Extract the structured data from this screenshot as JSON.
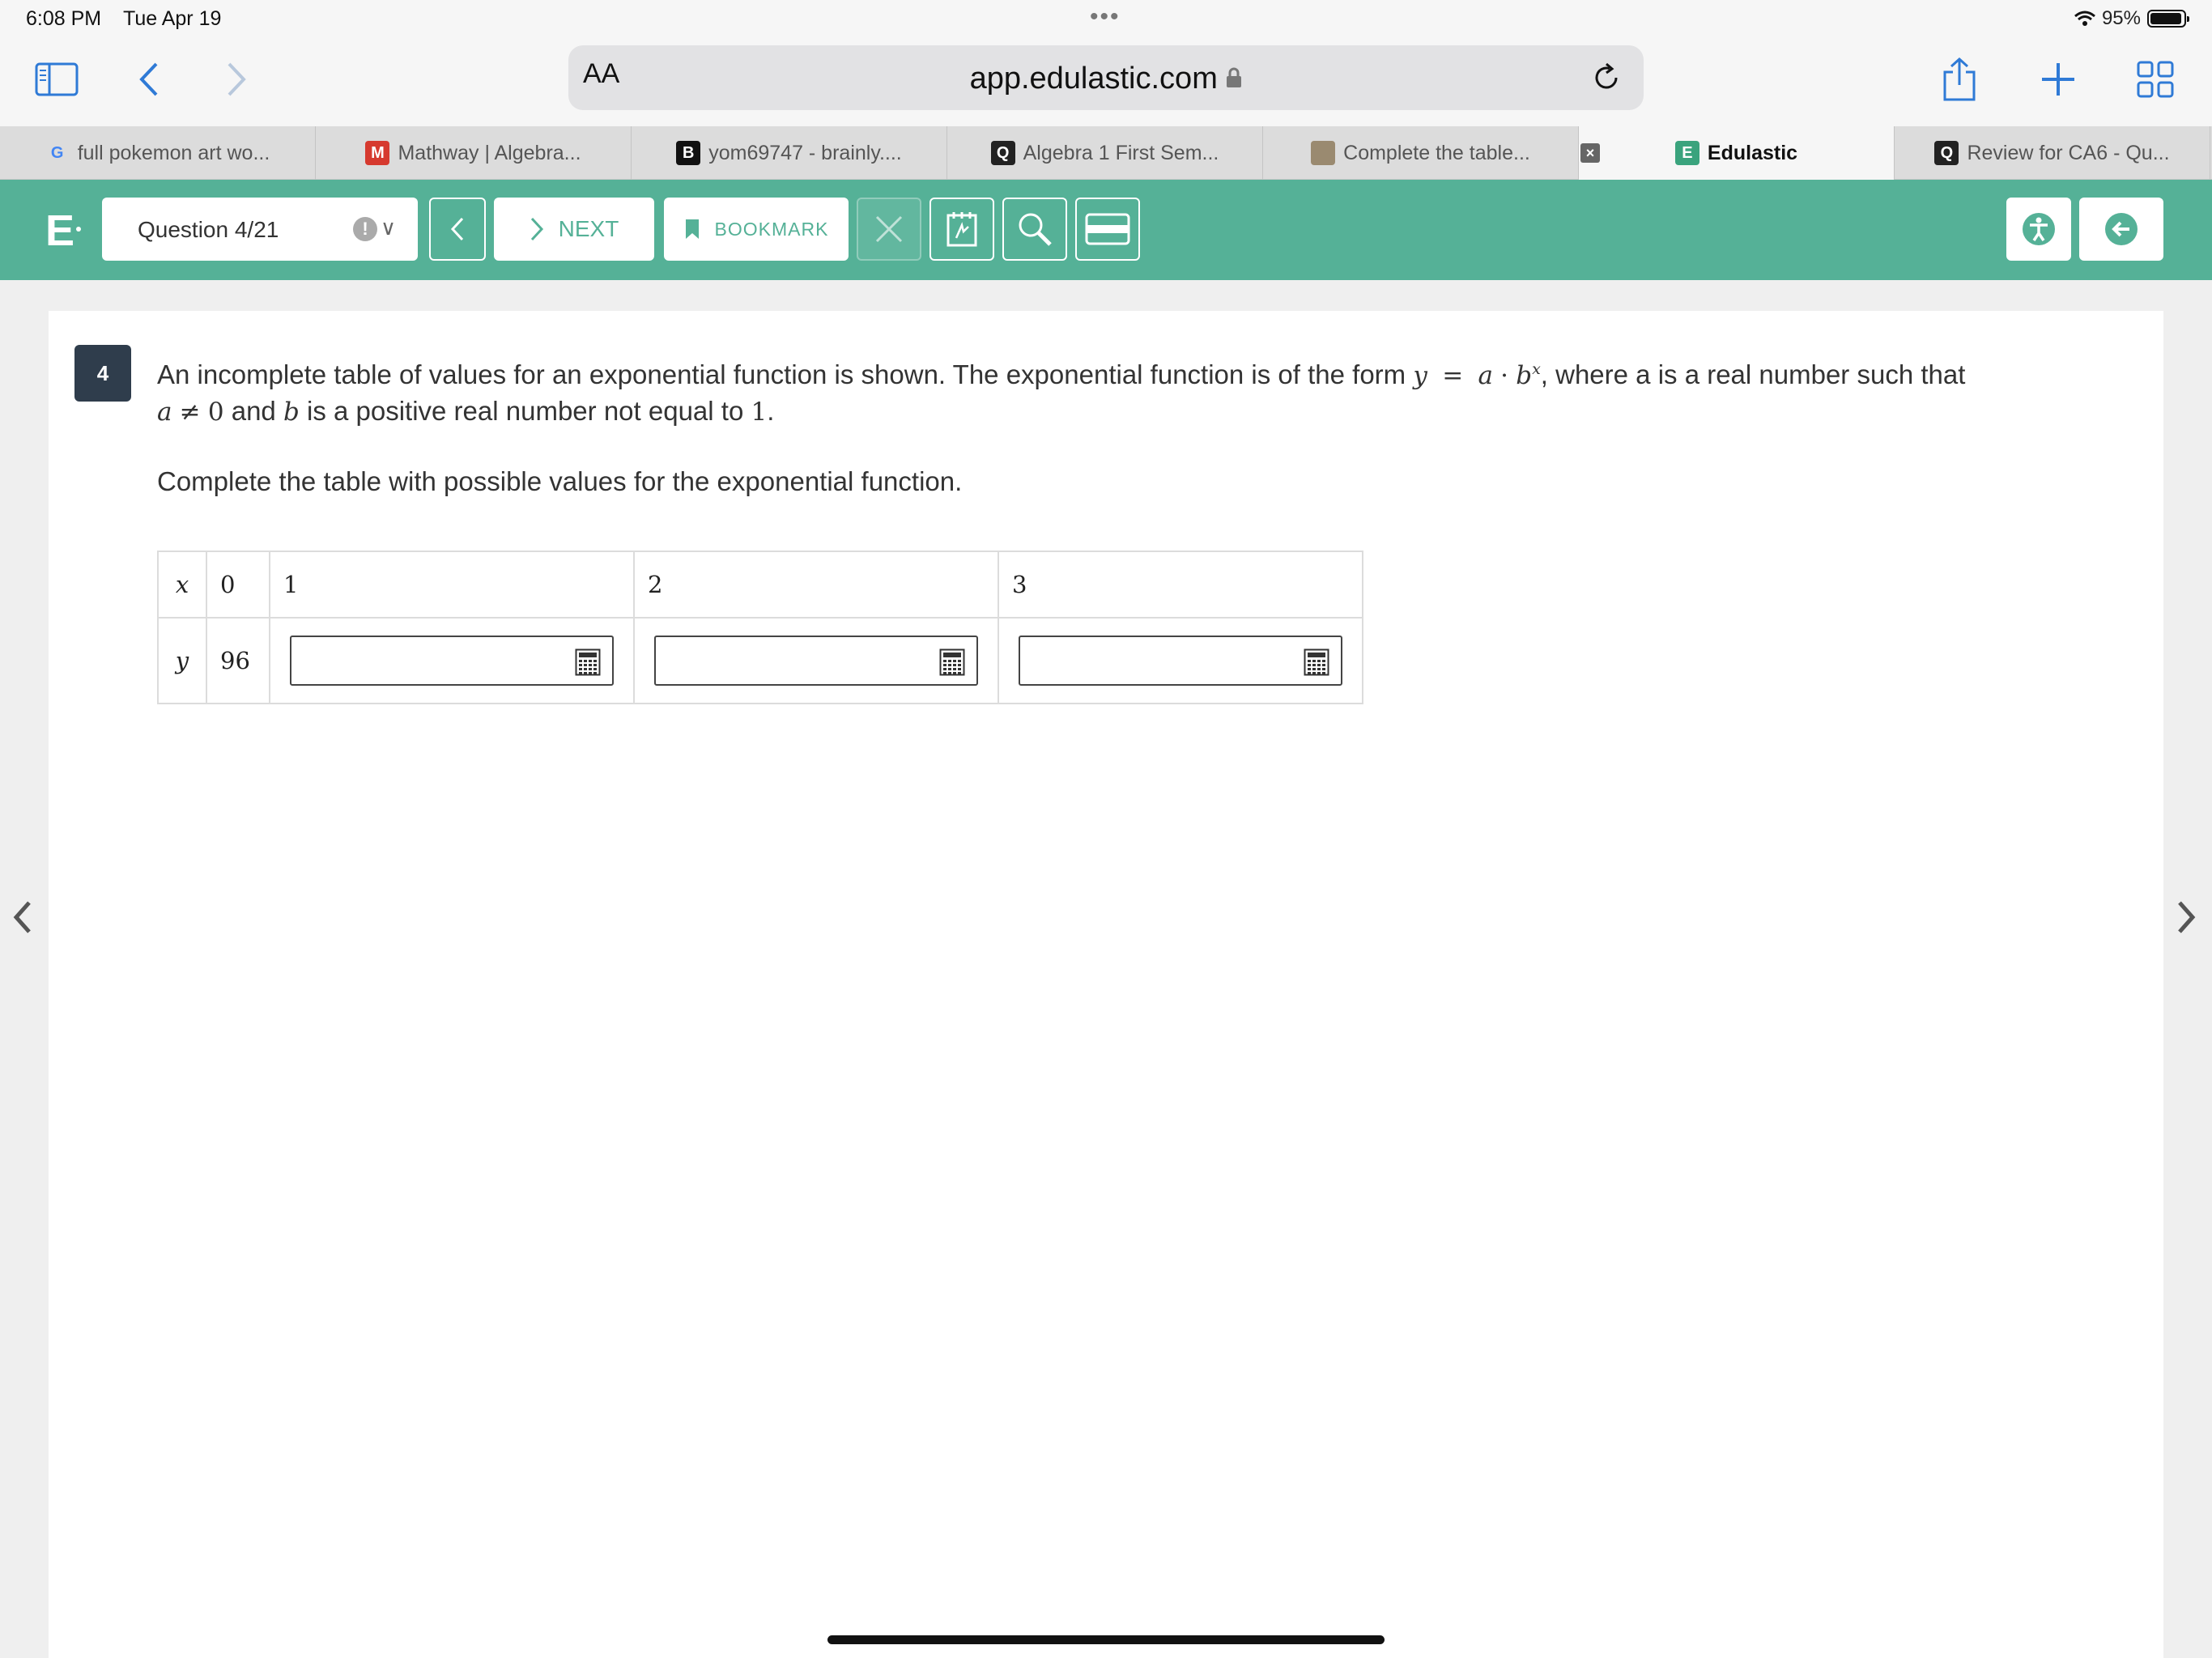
{
  "status_bar": {
    "time": "6:08 PM",
    "date": "Tue Apr 19",
    "battery": "95%",
    "battery_level": 0.95
  },
  "browser": {
    "text_size_button": "AA",
    "url": "app.edulastic.com",
    "tabs": [
      {
        "label": "full pokemon art wo...",
        "favicon": "google-icon",
        "favicon_text": "G",
        "favicon_color": "#4285f4"
      },
      {
        "label": "Mathway | Algebra...",
        "favicon": "mathway-icon",
        "favicon_text": "M",
        "favicon_color": "#d63a2f"
      },
      {
        "label": "yom69747 - brainly....",
        "favicon": "brainly-icon",
        "favicon_text": "B",
        "favicon_color": "#111111"
      },
      {
        "label": "Algebra 1 First Sem...",
        "favicon": "quizizz-icon",
        "favicon_text": "Q",
        "favicon_color": "#222222"
      },
      {
        "label": "Complete the table...",
        "favicon": "image-thumbnail-icon",
        "favicon_text": "",
        "favicon_color": "#9a8a70"
      },
      {
        "label": "Edulastic",
        "favicon": "edulastic-icon",
        "favicon_text": "E",
        "favicon_color": "#3aa37d",
        "active": true
      },
      {
        "label": "Review for CA6 - Qu...",
        "favicon": "quizizz-icon",
        "favicon_text": "Q",
        "favicon_color": "#222222"
      }
    ]
  },
  "edulastic": {
    "logo": "E",
    "question_selector": "Question 4/21",
    "next_label": "NEXT",
    "bookmark_label": "BOOKMARK",
    "colors": {
      "header": "#55b197",
      "badge": "#2f3d4c"
    }
  },
  "question": {
    "number": "4",
    "stem": {
      "part1": "An incomplete table of values for an exponential function is shown. The exponential function is of the form ",
      "y": "y",
      "eq": "=",
      "a": "a",
      "dot": "·",
      "b": "b",
      "exp": "x",
      "part2": ", where a is a real number such that",
      "a2": "a",
      "neq": "≠",
      "zero": "0",
      "part3": " and ",
      "b2": "b",
      "part4": " is a positive real number not equal to ",
      "one": "1",
      "end": "."
    },
    "instruction": "Complete the table with possible values for the exponential function.",
    "table": {
      "x_label": "x",
      "y_label": "y",
      "x_values": [
        "0",
        "1",
        "2",
        "3"
      ],
      "y_given": "96",
      "answers": [
        "",
        "",
        ""
      ]
    }
  }
}
